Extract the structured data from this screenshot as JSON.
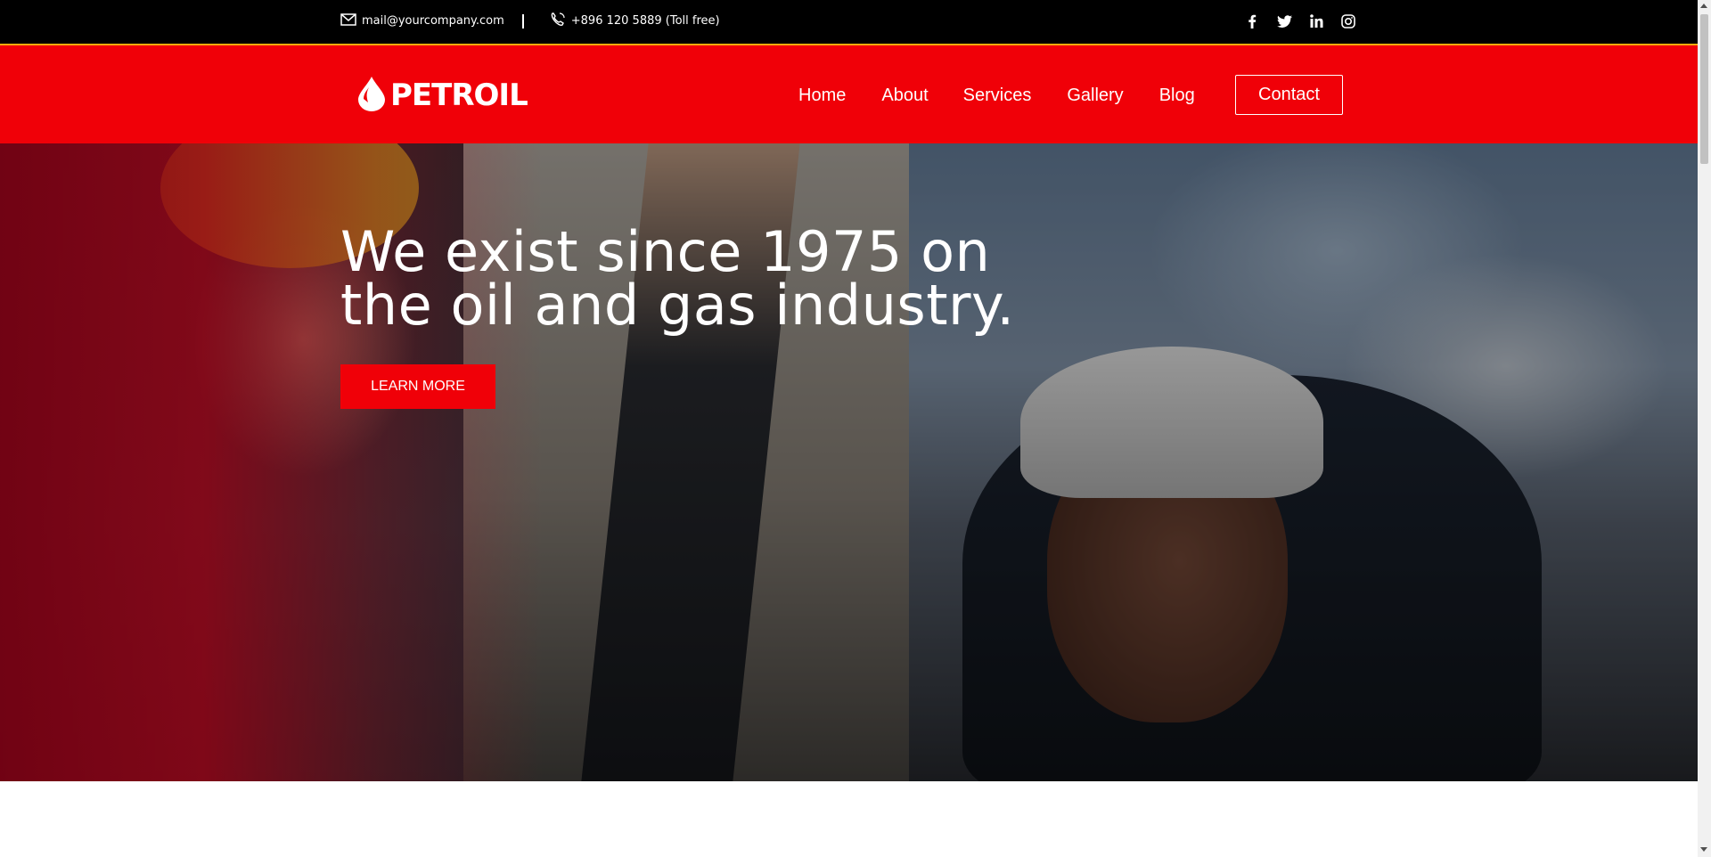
{
  "topbar": {
    "email": "mail@yourcompany.com",
    "phone": "+896 120 5889 (Toll free)",
    "email_icon": "mail-icon",
    "phone_icon": "phone-icon",
    "social": [
      "facebook-icon",
      "twitter-icon",
      "linkedin-icon",
      "instagram-icon"
    ]
  },
  "header": {
    "logo_text": "PETROIL",
    "logo_icon": "oil-drop-icon",
    "nav": [
      "Home",
      "About",
      "Services",
      "Gallery",
      "Blog"
    ],
    "contact_label": "Contact",
    "brand_color": "#f00008"
  },
  "hero": {
    "title": "We exist since 1975 on the oil and gas industry.",
    "button_label": "LEARN MORE"
  }
}
